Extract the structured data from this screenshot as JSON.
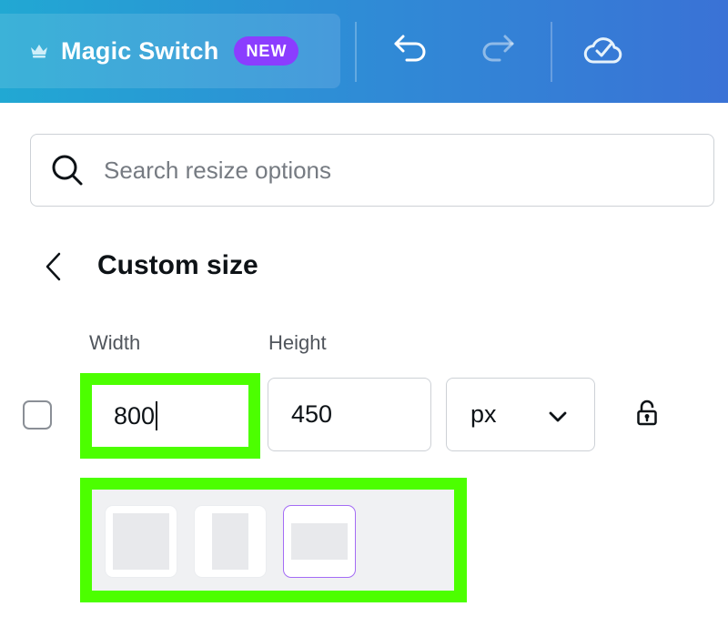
{
  "topbar": {
    "magic_switch_label": "Magic Switch",
    "new_badge": "NEW",
    "icons": {
      "crown": "crown-icon",
      "undo": "undo-icon",
      "redo": "redo-icon",
      "cloud_saved": "cloud-check-icon"
    },
    "redo_enabled": false,
    "gradient_colors": [
      "#21a8d3",
      "#3a72d6"
    ],
    "badge_color": "#8b3dff"
  },
  "search": {
    "placeholder": "Search resize options",
    "value": ""
  },
  "panel": {
    "title": "Custom size",
    "width_label": "Width",
    "height_label": "Height",
    "width_value": "800",
    "height_value": "450",
    "unit": "px",
    "lock_state": "unlocked",
    "checkbox_checked": false
  },
  "presets": [
    {
      "name": "square",
      "selected": false
    },
    {
      "name": "portrait",
      "selected": false
    },
    {
      "name": "landscape",
      "selected": true
    }
  ],
  "highlight_color": "#4cff00",
  "selected_color": "#a46cf5"
}
